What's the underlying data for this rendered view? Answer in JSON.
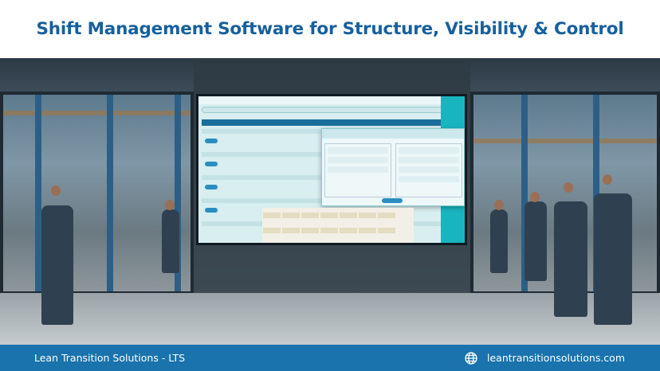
{
  "header": {
    "title": "Shift Management Software for Structure, Visibility & Control"
  },
  "footer": {
    "company": "Lean Transition Solutions - LTS",
    "website": "leantransitionsolutions.com",
    "website_icon": "globe-icon"
  },
  "colors": {
    "title": "#17609e",
    "footer_bg": "#1a73ad",
    "screen_accent": "#19b5bf"
  }
}
